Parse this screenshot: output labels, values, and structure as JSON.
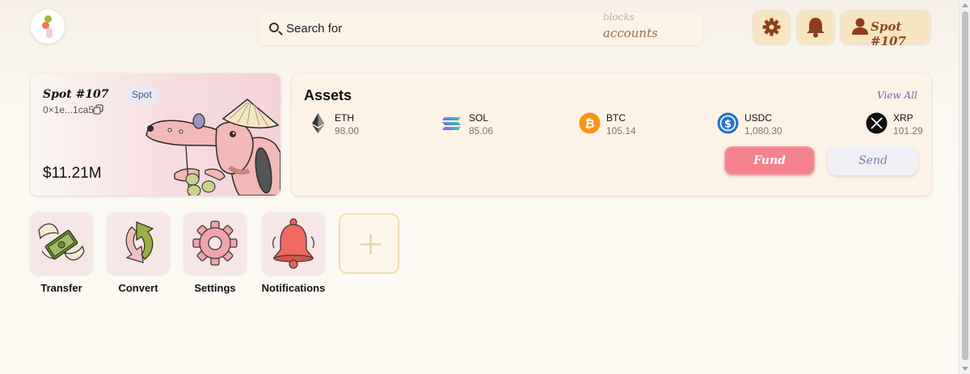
{
  "header": {
    "search_label": "Search for",
    "search_rotating_prev": "blocks",
    "search_rotating_word": "accounts",
    "account_name": "Spot #107"
  },
  "profile": {
    "name": "Spot #107",
    "badge": "Spot",
    "address": "0×1e...1ca5",
    "balance": "$11.21M"
  },
  "assets": {
    "title": "Assets",
    "view_all": "View All",
    "coins": [
      {
        "symbol": "ETH",
        "amount": "98.00",
        "icon": "ethereum-icon"
      },
      {
        "symbol": "SOL",
        "amount": "85.06",
        "icon": "solana-icon"
      },
      {
        "symbol": "BTC",
        "amount": "105.14",
        "icon": "bitcoin-icon"
      },
      {
        "symbol": "USDC",
        "amount": "1,080.30",
        "icon": "usdc-icon"
      },
      {
        "symbol": "XRP",
        "amount": "101.29",
        "icon": "xrp-icon"
      }
    ],
    "fund_label": "Fund",
    "send_label": "Send"
  },
  "actions": [
    {
      "label": "Transfer",
      "icon": "flying-money-icon"
    },
    {
      "label": "Convert",
      "icon": "convert-arrows-icon"
    },
    {
      "label": "Settings",
      "icon": "gear-icon"
    },
    {
      "label": "Notifications",
      "icon": "bell-icon"
    }
  ],
  "colors": {
    "accent_fund": "#f3828d",
    "header_button": "#f6e4c2",
    "account_text": "#8d4a20",
    "view_all": "#6d6ba3"
  }
}
